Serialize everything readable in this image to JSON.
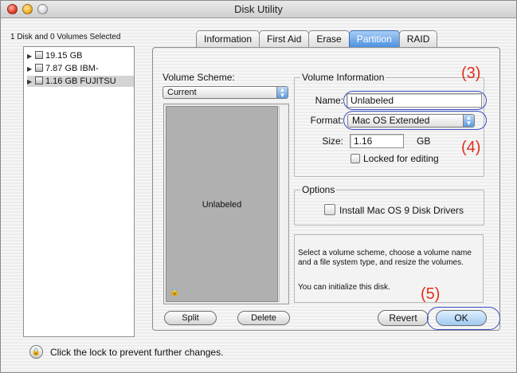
{
  "window": {
    "title": "Disk Utility"
  },
  "selection_info": "1 Disk and 0 Volumes Selected",
  "disks": [
    {
      "label": "19.15 GB",
      "selected": false
    },
    {
      "label": "7.87 GB IBM-",
      "selected": false
    },
    {
      "label": "1.16 GB FUJITSU",
      "selected": true
    }
  ],
  "tabs": [
    {
      "label": "Information",
      "active": false
    },
    {
      "label": "First Aid",
      "active": false
    },
    {
      "label": "Erase",
      "active": false
    },
    {
      "label": "Partition",
      "active": true
    },
    {
      "label": "RAID",
      "active": false
    }
  ],
  "volume_scheme": {
    "label": "Volume Scheme:",
    "selected": "Current",
    "volume_name": "Unlabeled"
  },
  "volume_info": {
    "group_title": "Volume Information",
    "name_label": "Name:",
    "name_value": "Unlabeled",
    "format_label": "Format:",
    "format_value": "Mac OS Extended",
    "size_label": "Size:",
    "size_value": "1.16",
    "size_unit": "GB",
    "locked_label": "Locked for editing",
    "locked_checked": false
  },
  "options": {
    "group_title": "Options",
    "install_drivers_label": "Install Mac OS 9 Disk Drivers",
    "install_drivers_checked": false
  },
  "help": {
    "line1": "Select a volume scheme, choose a volume name and a file system type, and resize the volumes.",
    "line2": "You can initialize this disk."
  },
  "buttons": {
    "split": "Split",
    "delete": "Delete",
    "revert": "Revert",
    "ok": "OK"
  },
  "annotations": {
    "a3": "(3)",
    "a4": "(4)",
    "a5": "(5)"
  },
  "status": {
    "lock_text": "Click the lock to prevent further changes."
  },
  "colors": {
    "annotation": "#e0301c",
    "highlight_ring": "#3a4fc0",
    "active_tab": "#4a8fe0"
  }
}
